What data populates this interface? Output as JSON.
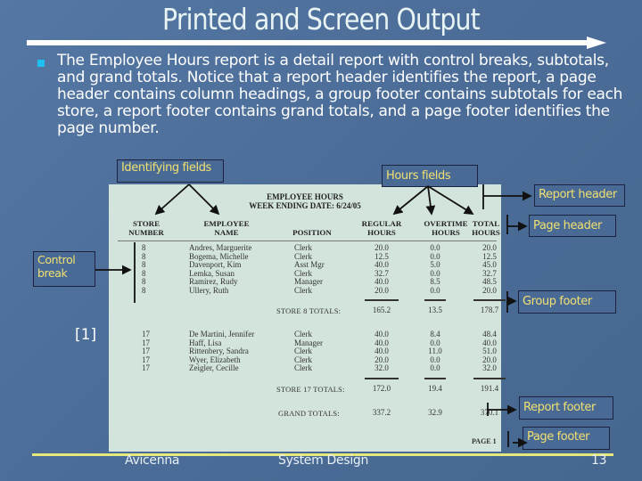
{
  "slide": {
    "title": "Printed and Screen Output",
    "bullet_text": "The Employee Hours report is a detail report with control breaks, subtotals, and grand totals. Notice that a report header identifies the report, a page header contains column headings, a group footer contains subtotals for each store, a report footer contains grand totals, and a page footer identifies the page number.",
    "reference": "[1]",
    "colors": {
      "background": "#4b6d98",
      "callout_text": "#f0e070",
      "bullet": "#1ec0f0",
      "footer_line": "#e6e87c",
      "report_bg": "#d3e4dc"
    }
  },
  "callouts": {
    "identifying_fields": "Identifying fields",
    "hours_fields": "Hours fields",
    "report_header": "Report header",
    "page_header": "Page header",
    "control_break": "Control break",
    "group_footer": "Group footer",
    "report_footer": "Report footer",
    "page_footer": "Page footer"
  },
  "report": {
    "title": "EMPLOYEE HOURS",
    "subtitle": "WEEK ENDING DATE:  6/24/05",
    "columns": [
      [
        "STORE",
        "NUMBER"
      ],
      [
        "EMPLOYEE",
        "NAME"
      ],
      [
        "",
        "POSITION"
      ],
      [
        "REGULAR",
        "HOURS"
      ],
      [
        "OVERTIME",
        "HOURS"
      ],
      [
        "TOTAL",
        "HOURS"
      ]
    ],
    "groups": [
      {
        "rows": [
          [
            "8",
            "Andres, Marguerite",
            "Clerk",
            "20.0",
            "0.0",
            "20.0"
          ],
          [
            "8",
            "Bogema, Michelle",
            "Clerk",
            "12.5",
            "0.0",
            "12.5"
          ],
          [
            "8",
            "Davenport, Kim",
            "Asst Mgr",
            "40.0",
            "5.0",
            "45.0"
          ],
          [
            "8",
            "Lemka, Susan",
            "Clerk",
            "32.7",
            "0.0",
            "32.7"
          ],
          [
            "8",
            "Ramirez, Rudy",
            "Manager",
            "40.0",
            "8.5",
            "48.5"
          ],
          [
            "8",
            "Ullery, Ruth",
            "Clerk",
            "20.0",
            "0.0",
            "20.0"
          ]
        ],
        "total_label": "STORE 8 TOTALS:",
        "totals": [
          "165.2",
          "13.5",
          "178.7"
        ]
      },
      {
        "rows": [
          [
            "17",
            "De Martini, Jennifer",
            "Clerk",
            "40.0",
            "8.4",
            "48.4"
          ],
          [
            "17",
            "Haff, Lisa",
            "Manager",
            "40.0",
            "0.0",
            "40.0"
          ],
          [
            "17",
            "Rittenbery, Sandra",
            "Clerk",
            "40.0",
            "11.0",
            "51.0"
          ],
          [
            "17",
            "Wyer, Elizabeth",
            "Clerk",
            "20.0",
            "0.0",
            "20.0"
          ],
          [
            "17",
            "Zeigler, Cecille",
            "Clerk",
            "32.0",
            "0.0",
            "32.0"
          ]
        ],
        "total_label": "STORE 17 TOTALS:",
        "totals": [
          "172.0",
          "19.4",
          "191.4"
        ]
      }
    ],
    "grand_total_label": "GRAND TOTALS:",
    "grand_totals": [
      "337.2",
      "32.9",
      "370.1"
    ],
    "page_label": "PAGE 1"
  },
  "footer": {
    "left": "Avicenna",
    "center": "System Design",
    "page_number": "13"
  }
}
